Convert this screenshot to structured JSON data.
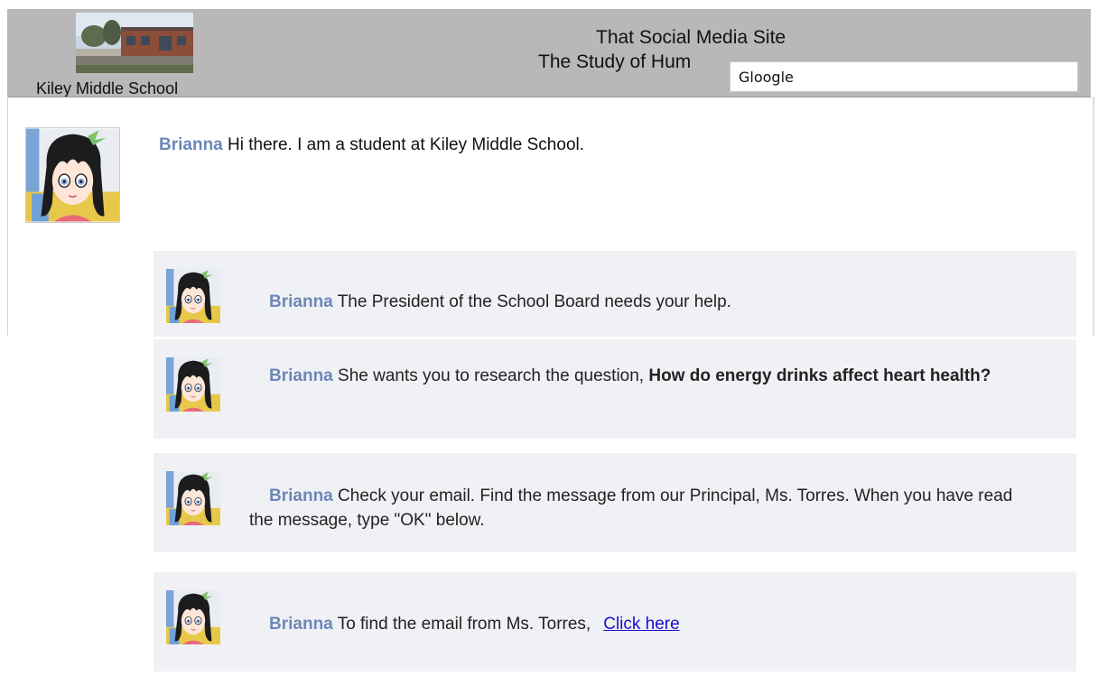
{
  "header": {
    "school_name": "Kiley Middle School",
    "site_title": "That Social Media Site",
    "site_subtitle": "The Study of Hum",
    "search_value": "Gloogle"
  },
  "top_post": {
    "author": "Brianna",
    "text": "Hi there. I am a student at Kiley Middle School."
  },
  "messages": [
    {
      "author": "Brianna",
      "text": "The President of the School Board needs your help."
    },
    {
      "author": "Brianna",
      "text": "She wants you to research the question, ",
      "bold_text": "How do energy drinks affect heart health?"
    },
    {
      "author": "Brianna",
      "text": "Check your email. Find the message from our Principal, Ms. Torres. When you have read the message, type \"OK\" below."
    },
    {
      "author": "Brianna",
      "text": "To find the email from Ms. Torres,",
      "link_text": "Click here"
    }
  ],
  "colors": {
    "header_bg": "#b8b8b8",
    "card_bg": "#f0f1f5",
    "author_name": "#6b88b8",
    "link": "#1a0dcc"
  },
  "icons": {
    "avatar": "anime-girl-avatar-icon",
    "school_photo": "school-building-photo"
  }
}
